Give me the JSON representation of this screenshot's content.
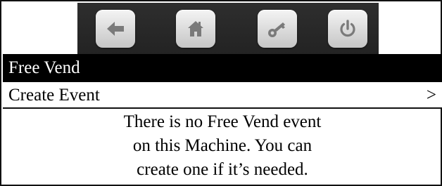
{
  "toolbar": {
    "buttons": [
      {
        "icon": "back-arrow-icon"
      },
      {
        "icon": "home-icon"
      },
      {
        "icon": "key-icon"
      },
      {
        "icon": "power-icon"
      }
    ],
    "icon_color": "#7a7a7a",
    "background": "#2a2a2a"
  },
  "title_bar": {
    "text": "Free Vend"
  },
  "menu": {
    "create_event": {
      "label": "Create Event",
      "chevron": ">"
    }
  },
  "message": {
    "lines": [
      "There is no Free Vend event",
      "on this Machine.  You can",
      "create one if it’s needed."
    ]
  }
}
